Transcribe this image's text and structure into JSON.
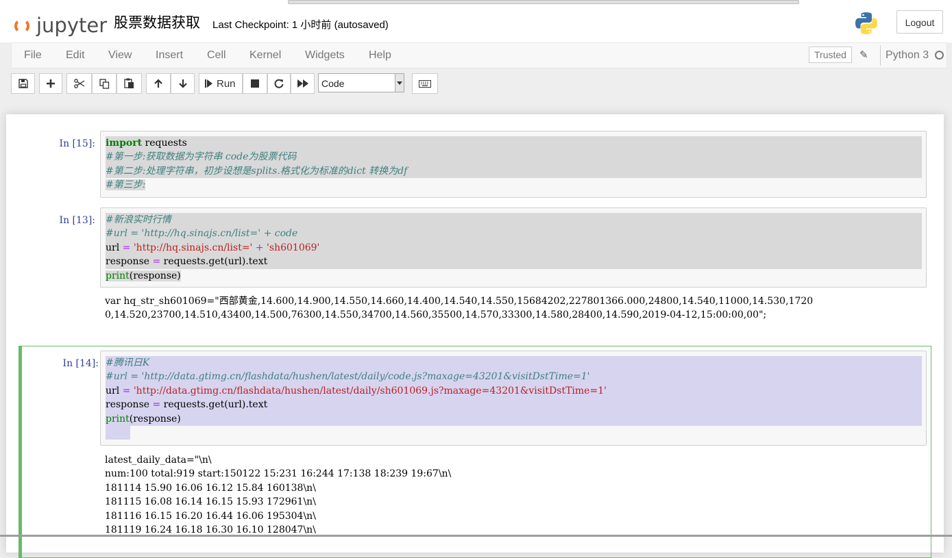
{
  "header": {
    "logo_text": "jupyter",
    "notebook_title": "股票数据获取",
    "checkpoint": "Last Checkpoint: 1 小时前  (autosaved)",
    "logout_label": "Logout"
  },
  "menubar": {
    "items": [
      "File",
      "Edit",
      "View",
      "Insert",
      "Cell",
      "Kernel",
      "Widgets",
      "Help"
    ],
    "trusted_label": "Trusted",
    "kernel_name": "Python 3"
  },
  "toolbar": {
    "run_label": "Run",
    "cell_type": "Code"
  },
  "cells": [
    {
      "prompt": "In [15]:",
      "lines": [
        [
          [
            "kw",
            "import"
          ],
          [
            "tx",
            " requests"
          ]
        ],
        [
          [
            "cm",
            "#第一步:获取数据为字符串 code为股票代码"
          ]
        ],
        [
          [
            "cm",
            "#第二步:处理字符串，初步设想是splits.格式化为标准的dict 转换为df"
          ]
        ],
        [
          [
            "cm",
            "#第三步:"
          ]
        ]
      ]
    },
    {
      "prompt": "In [13]:",
      "lines": [
        [
          [
            "cm",
            "#新浪实时行情"
          ]
        ],
        [
          [
            "cm",
            "#url = 'http://hq.sinajs.cn/list=' + code"
          ]
        ],
        [
          [
            "tx",
            "url "
          ],
          [
            "op",
            "="
          ],
          [
            "tx",
            " "
          ],
          [
            "st",
            "'http://hq.sinajs.cn/list='"
          ],
          [
            "tx",
            " "
          ],
          [
            "op",
            "+"
          ],
          [
            "tx",
            " "
          ],
          [
            "st",
            "'sh601069'"
          ]
        ],
        [
          [
            "tx",
            "response "
          ],
          [
            "op",
            "="
          ],
          [
            "tx",
            " requests.get(url).text"
          ]
        ],
        [
          [
            "bi",
            "print"
          ],
          [
            "tx",
            "(response)"
          ]
        ]
      ],
      "output": [
        "var hq_str_sh601069=\"西部黄金,14.600,14.900,14.550,14.660,14.400,14.540,14.550,15684202,227801366.000,24800,14.540,11000,14.530,1720",
        "0,14.520,23700,14.510,43400,14.500,76300,14.550,34700,14.560,35500,14.570,33300,14.580,28400,14.590,2019-04-12,15:00:00,00\";"
      ]
    },
    {
      "prompt": "In [14]:",
      "lines": [
        [
          [
            "cm",
            "#腾讯日K"
          ]
        ],
        [
          [
            "cm",
            "#url = 'http://data.gtimg.cn/flashdata/hushen/latest/daily/code.js?maxage=43201&visitDstTime=1'"
          ]
        ],
        [
          [
            "tx",
            "url "
          ],
          [
            "op",
            "="
          ],
          [
            "tx",
            " "
          ],
          [
            "st",
            "'http://data.gtimg.cn/flashdata/hushen/latest/daily/sh601069.js?maxage=43201&visitDstTime=1'"
          ]
        ],
        [
          [
            "tx",
            "response "
          ],
          [
            "op",
            "="
          ],
          [
            "tx",
            " requests.get(url).text"
          ]
        ],
        [
          [
            "bi",
            "print"
          ],
          [
            "tx",
            "(response)"
          ]
        ]
      ],
      "output": [
        "latest_daily_data=\"\\n\\",
        "num:100 total:919 start:150122 15:231 16:244 17:138 18:239 19:67\\n\\",
        "181114 15.90 16.06 16.12 15.84 160138\\n\\",
        "181115 16.08 16.14 16.15 15.93 172961\\n\\",
        "181116 16.15 16.20 16.44 16.06 195304\\n\\",
        "181119 16.24 16.18 16.30 16.10 128047\\n\\"
      ]
    }
  ]
}
